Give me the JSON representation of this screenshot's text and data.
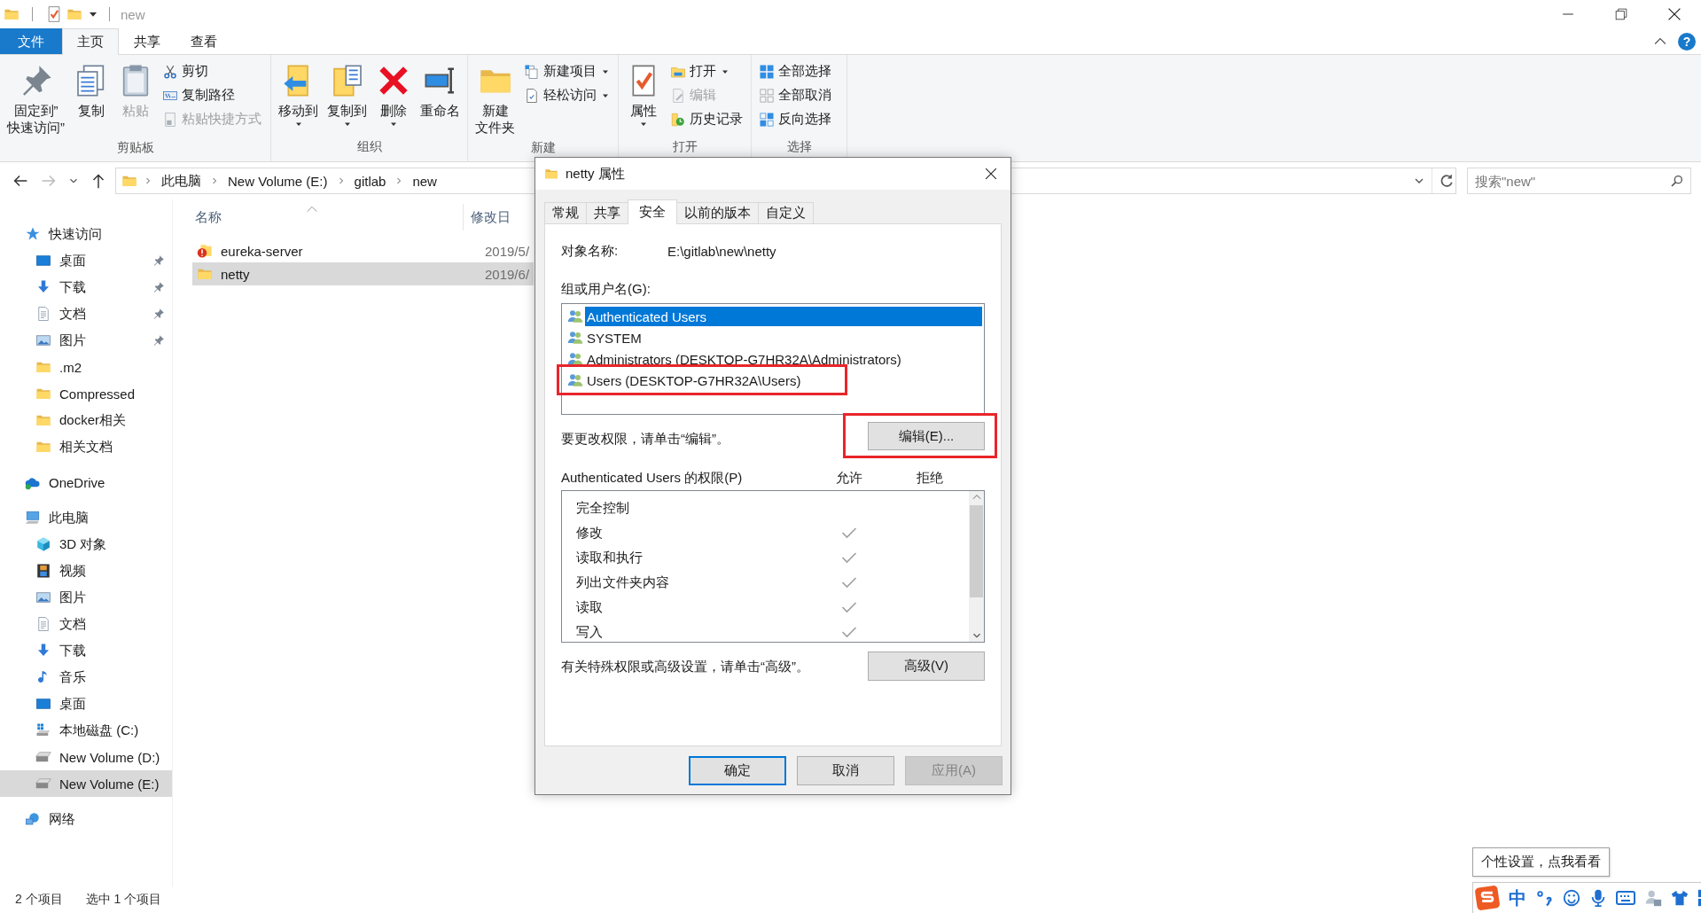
{
  "title_bar": {
    "title": "new"
  },
  "ribbon": {
    "tabs": [
      {
        "label": "文件",
        "kind": "file",
        "selected": false
      },
      {
        "label": "主页",
        "kind": "tab",
        "selected": true
      },
      {
        "label": "共享",
        "kind": "tab",
        "selected": false
      },
      {
        "label": "查看",
        "kind": "tab",
        "selected": false
      }
    ],
    "help": "?",
    "groups": [
      {
        "label": "剪贴板",
        "items": [
          {
            "lines": [
              "固定到”",
              "快速访问”"
            ],
            "kind": "large",
            "disabled": false,
            "dropdown": false
          },
          {
            "label": "复制",
            "kind": "large",
            "disabled": false,
            "dropdown": false
          },
          {
            "label": "粘贴",
            "kind": "large",
            "disabled": true,
            "dropdown": false
          },
          {
            "label": "剪切",
            "kind": "small",
            "disabled": false,
            "dropdown": false
          },
          {
            "label": "复制路径",
            "kind": "small",
            "disabled": false,
            "dropdown": false
          },
          {
            "label": "粘贴快捷方式",
            "kind": "small",
            "disabled": true,
            "dropdown": false
          }
        ]
      },
      {
        "label": "组织",
        "items": [
          {
            "label": "移动到",
            "kind": "large",
            "disabled": false,
            "dropdown": true
          },
          {
            "label": "复制到",
            "kind": "large",
            "disabled": false,
            "dropdown": true
          },
          {
            "label": "删除",
            "kind": "large",
            "disabled": false,
            "dropdown": true
          },
          {
            "label": "重命名",
            "kind": "large",
            "disabled": false,
            "dropdown": false
          }
        ]
      },
      {
        "label": "新建",
        "items": [
          {
            "lines": [
              "新建",
              "文件夹"
            ],
            "kind": "large",
            "disabled": false,
            "dropdown": false
          },
          {
            "label": "新建项目",
            "kind": "small",
            "disabled": false,
            "dropdown": true
          },
          {
            "label": "轻松访问",
            "kind": "small",
            "disabled": false,
            "dropdown": true
          }
        ]
      },
      {
        "label": "打开",
        "items": [
          {
            "label": "属性",
            "kind": "large",
            "disabled": false,
            "dropdown": true
          },
          {
            "label": "打开",
            "kind": "small",
            "disabled": false,
            "dropdown": true
          },
          {
            "label": "编辑",
            "kind": "small",
            "disabled": true,
            "dropdown": false
          },
          {
            "label": "历史记录",
            "kind": "small",
            "disabled": false,
            "dropdown": false
          }
        ]
      },
      {
        "label": "选择",
        "items": [
          {
            "label": "全部选择",
            "kind": "small",
            "disabled": false,
            "dropdown": false
          },
          {
            "label": "全部取消",
            "kind": "small",
            "disabled": false,
            "dropdown": false
          },
          {
            "label": "反向选择",
            "kind": "small",
            "disabled": false,
            "dropdown": false
          }
        ]
      }
    ]
  },
  "address_bar": {
    "path": [
      "此电脑",
      "New Volume (E:)",
      "gitlab",
      "new"
    ],
    "search": {
      "placeholder": "搜索\"new\""
    }
  },
  "nav_pane": {
    "items": [
      {
        "label": "快速访问",
        "selected": false,
        "children": [
          {
            "label": "桌面",
            "pinned": true,
            "selected": false
          },
          {
            "label": "下载",
            "pinned": true,
            "selected": false
          },
          {
            "label": "文档",
            "pinned": true,
            "selected": false
          },
          {
            "label": "图片",
            "pinned": true,
            "selected": false
          },
          {
            "label": ".m2",
            "pinned": false,
            "selected": false
          },
          {
            "label": "Compressed",
            "pinned": false,
            "selected": false
          },
          {
            "label": "docker相关",
            "pinned": false,
            "selected": false
          },
          {
            "label": "相关文档",
            "pinned": false,
            "selected": false
          }
        ]
      },
      {
        "label": "OneDrive",
        "selected": false
      },
      {
        "label": "此电脑",
        "selected": false,
        "children": [
          {
            "label": "3D 对象",
            "selected": false
          },
          {
            "label": "视频",
            "selected": false
          },
          {
            "label": "图片",
            "selected": false
          },
          {
            "label": "文档",
            "selected": false
          },
          {
            "label": "下载",
            "selected": false
          },
          {
            "label": "音乐",
            "selected": false
          },
          {
            "label": "桌面",
            "selected": false
          },
          {
            "label": "本地磁盘 (C:)",
            "selected": false
          },
          {
            "label": "New Volume (D:)",
            "selected": false
          },
          {
            "label": "New Volume (E:)",
            "selected": true
          }
        ]
      },
      {
        "label": "网络",
        "selected": false
      }
    ]
  },
  "file_list": {
    "columns": [
      "名称",
      "修改日"
    ],
    "rows": [
      {
        "name": "eureka-server",
        "date": "2019/5/",
        "selected": false
      },
      {
        "name": "netty",
        "date": "2019/6/",
        "selected": true
      }
    ]
  },
  "status_bar": {
    "item_count": "2 个项目",
    "selection": "选中 1 个项目"
  },
  "dialog": {
    "title": "netty 属性",
    "tabs": [
      {
        "label": "常规",
        "selected": false
      },
      {
        "label": "共享",
        "selected": false
      },
      {
        "label": "安全",
        "selected": true
      },
      {
        "label": "以前的版本",
        "selected": false
      },
      {
        "label": "自定义",
        "selected": false
      }
    ],
    "object_name_label": "对象名称:",
    "object_name": "E:\\gitlab\\new\\netty",
    "users_label": "组或用户名(G):",
    "users": [
      {
        "name": "Authenticated Users",
        "selected": true,
        "highlighted": false
      },
      {
        "name": "SYSTEM",
        "selected": false,
        "highlighted": false
      },
      {
        "name": "Administrators (DESKTOP-G7HR32A\\Administrators)",
        "selected": false,
        "highlighted": false
      },
      {
        "name": "Users (DESKTOP-G7HR32A\\Users)",
        "selected": false,
        "highlighted": true
      }
    ],
    "edit_hint": "要更改权限，请单击“编辑”。",
    "edit_button": {
      "label": "编辑(E)...",
      "highlighted": true
    },
    "permissions_label": "Authenticated Users 的权限(P)",
    "allow_label": "允许",
    "deny_label": "拒绝",
    "permissions": [
      {
        "name": "完全控制",
        "allow": false,
        "deny": false
      },
      {
        "name": "修改",
        "allow": true,
        "deny": false
      },
      {
        "name": "读取和执行",
        "allow": true,
        "deny": false
      },
      {
        "name": "列出文件夹内容",
        "allow": true,
        "deny": false
      },
      {
        "name": "读取",
        "allow": true,
        "deny": false
      },
      {
        "name": "写入",
        "allow": true,
        "deny": false
      }
    ],
    "advanced_hint": "有关特殊权限或高级设置，请单击“高级”。",
    "advanced_button": "高级(V)",
    "buttons": [
      {
        "label": "确定",
        "kind": "default",
        "disabled": false
      },
      {
        "label": "取消",
        "kind": "normal",
        "disabled": false
      },
      {
        "label": "应用(A)",
        "kind": "normal",
        "disabled": true
      }
    ]
  },
  "tooltip": "个性设置，点我看看",
  "ime_bar": {
    "mode": "中"
  }
}
